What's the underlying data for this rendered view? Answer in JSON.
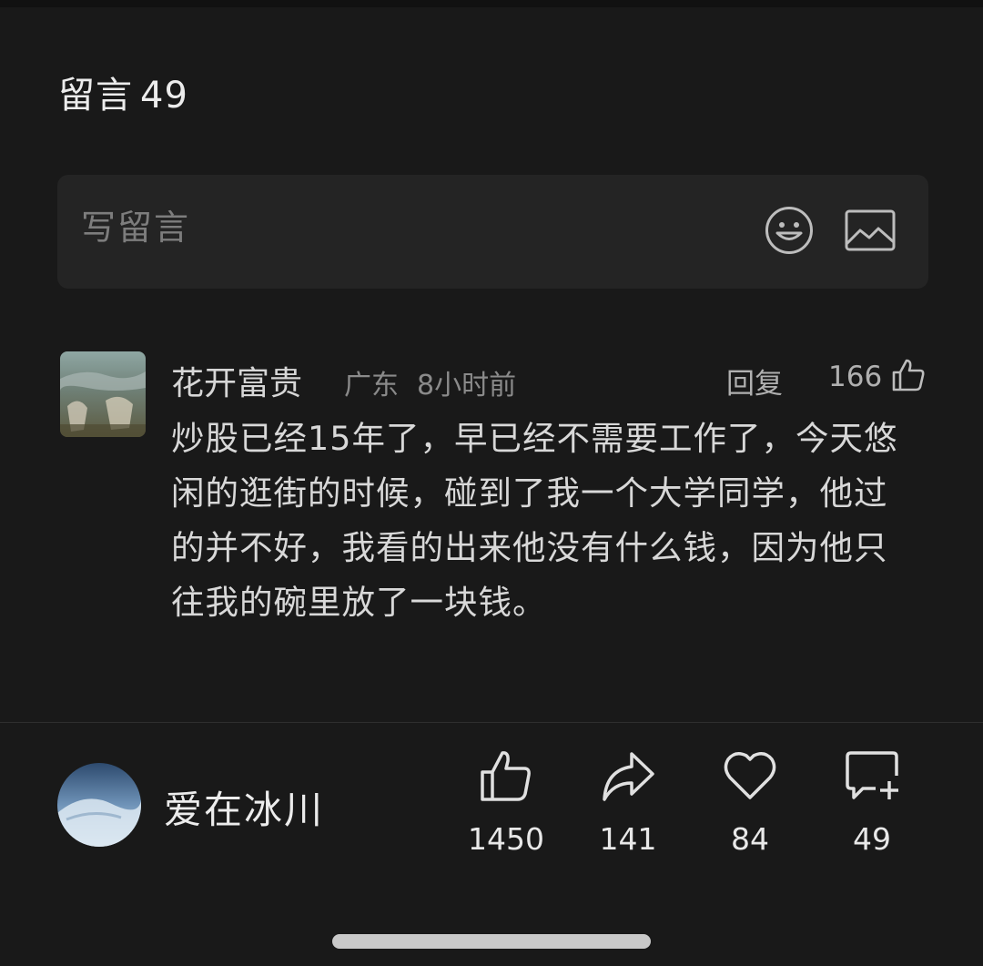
{
  "header": {
    "title": "留言",
    "count": "49"
  },
  "composer": {
    "placeholder": "写留言",
    "emoji_icon": "smiley-icon",
    "image_icon": "image-icon"
  },
  "comment": {
    "username": "花开富贵",
    "location": "广东",
    "time": "8小时前",
    "reply_label": "回复",
    "likes": "166",
    "text": "炒股已经15年了，早已经不需要工作了，今天悠闲的逛街的时候，碰到了我一个大学同学，他过的并不好，我看的出来他没有什么钱，因为他只往我的碗里放了一块钱。"
  },
  "author": {
    "name": "爱在冰川"
  },
  "actions": [
    {
      "name": "like",
      "icon": "thumbs-up-icon",
      "count": "1450"
    },
    {
      "name": "share",
      "icon": "share-arrow-icon",
      "count": "141"
    },
    {
      "name": "favorite",
      "icon": "heart-icon",
      "count": "84"
    },
    {
      "name": "comment",
      "icon": "comment-add-icon",
      "count": "49"
    }
  ],
  "colors": {
    "background": "#191919",
    "composer_bg": "#242424",
    "text_primary": "#e6e6e6",
    "text_secondary": "#8a8a8a"
  }
}
